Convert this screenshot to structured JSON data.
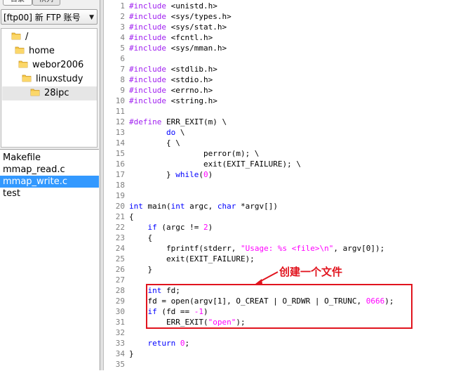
{
  "sidebar": {
    "tabs": [
      {
        "label": "目录"
      },
      {
        "label": "队列"
      }
    ],
    "account_selector": {
      "value": "[ftp00] 新 FTP 账号"
    },
    "tree": [
      {
        "label": "/",
        "depth": 0
      },
      {
        "label": "home",
        "depth": 1
      },
      {
        "label": "webor2006",
        "depth": 2
      },
      {
        "label": "linuxstudy",
        "depth": 3
      },
      {
        "label": "28ipc",
        "depth": 4,
        "selected": true
      }
    ],
    "files": [
      {
        "name": "Makefile"
      },
      {
        "name": "mmap_read.c"
      },
      {
        "name": "mmap_write.c",
        "selected": true
      },
      {
        "name": "test"
      }
    ]
  },
  "editor": {
    "lines": [
      {
        "n": "1",
        "code": [
          [
            "pp",
            "#include "
          ],
          [
            "",
            "<unistd.h>"
          ]
        ]
      },
      {
        "n": "2",
        "code": [
          [
            "pp",
            "#include "
          ],
          [
            "",
            "<sys/types.h>"
          ]
        ]
      },
      {
        "n": "3",
        "code": [
          [
            "pp",
            "#include "
          ],
          [
            "",
            "<sys/stat.h>"
          ]
        ]
      },
      {
        "n": "4",
        "code": [
          [
            "pp",
            "#include "
          ],
          [
            "",
            "<fcntl.h>"
          ]
        ]
      },
      {
        "n": "5",
        "code": [
          [
            "pp",
            "#include "
          ],
          [
            "",
            "<sys/mman.h>"
          ]
        ]
      },
      {
        "n": "6",
        "code": []
      },
      {
        "n": "7",
        "code": [
          [
            "pp",
            "#include "
          ],
          [
            "",
            "<stdlib.h>"
          ]
        ]
      },
      {
        "n": "8",
        "code": [
          [
            "pp",
            "#include "
          ],
          [
            "",
            "<stdio.h>"
          ]
        ]
      },
      {
        "n": "9",
        "code": [
          [
            "pp",
            "#include "
          ],
          [
            "",
            "<errno.h>"
          ]
        ]
      },
      {
        "n": "10",
        "code": [
          [
            "pp",
            "#include "
          ],
          [
            "",
            "<string.h>"
          ]
        ]
      },
      {
        "n": "11",
        "code": []
      },
      {
        "n": "12",
        "code": [
          [
            "pp",
            "#define "
          ],
          [
            "",
            "ERR_EXIT(m) \\"
          ]
        ]
      },
      {
        "n": "13",
        "code": [
          [
            "",
            "        "
          ],
          [
            "kw",
            "do"
          ],
          [
            "",
            " \\"
          ]
        ]
      },
      {
        "n": "14",
        "code": [
          [
            "",
            "        { \\"
          ]
        ]
      },
      {
        "n": "15",
        "code": [
          [
            "",
            "                perror(m); \\"
          ]
        ]
      },
      {
        "n": "16",
        "code": [
          [
            "",
            "                exit(EXIT_FAILURE); \\"
          ]
        ]
      },
      {
        "n": "17",
        "code": [
          [
            "",
            "        } "
          ],
          [
            "kw",
            "while"
          ],
          [
            "",
            "("
          ],
          [
            "num",
            "0"
          ],
          [
            "",
            ")"
          ]
        ]
      },
      {
        "n": "18",
        "code": []
      },
      {
        "n": "19",
        "code": []
      },
      {
        "n": "20",
        "code": [
          [
            "kw",
            "int"
          ],
          [
            "",
            " main("
          ],
          [
            "kw",
            "int"
          ],
          [
            "",
            " argc, "
          ],
          [
            "kw",
            "char"
          ],
          [
            "",
            " *argv[])"
          ]
        ]
      },
      {
        "n": "21",
        "code": [
          [
            "",
            "{"
          ]
        ]
      },
      {
        "n": "22",
        "code": [
          [
            "",
            "    "
          ],
          [
            "kw",
            "if"
          ],
          [
            "",
            " (argc != "
          ],
          [
            "num",
            "2"
          ],
          [
            "",
            ")"
          ]
        ]
      },
      {
        "n": "23",
        "code": [
          [
            "",
            "    {"
          ]
        ]
      },
      {
        "n": "24",
        "code": [
          [
            "",
            "        fprintf(stderr, "
          ],
          [
            "str",
            "\"Usage: %s <file>\\n\""
          ],
          [
            "",
            ", argv[0]);"
          ]
        ]
      },
      {
        "n": "25",
        "code": [
          [
            "",
            "        exit(EXIT_FAILURE);"
          ]
        ]
      },
      {
        "n": "26",
        "code": [
          [
            "",
            "    }"
          ]
        ]
      },
      {
        "n": "27",
        "code": []
      },
      {
        "n": "28",
        "code": [
          [
            "",
            "    "
          ],
          [
            "kw",
            "int"
          ],
          [
            "",
            " fd;"
          ]
        ]
      },
      {
        "n": "29",
        "code": [
          [
            "",
            "    fd = open(argv[1], O_CREAT | O_RDWR | O_TRUNC, "
          ],
          [
            "num",
            "0666"
          ],
          [
            "",
            ");"
          ]
        ]
      },
      {
        "n": "30",
        "code": [
          [
            "",
            "    "
          ],
          [
            "kw",
            "if"
          ],
          [
            "",
            " (fd == "
          ],
          [
            "num",
            "-1"
          ],
          [
            "",
            ")"
          ]
        ]
      },
      {
        "n": "31",
        "code": [
          [
            "",
            "        ERR_EXIT("
          ],
          [
            "str",
            "\"open\""
          ],
          [
            "",
            ");"
          ]
        ]
      },
      {
        "n": "32",
        "code": []
      },
      {
        "n": "33",
        "code": [
          [
            "",
            "    "
          ],
          [
            "kw",
            "return"
          ],
          [
            "",
            " "
          ],
          [
            "num",
            "0"
          ],
          [
            "",
            ";"
          ]
        ]
      },
      {
        "n": "34",
        "code": [
          [
            "",
            "}"
          ]
        ]
      },
      {
        "n": "35",
        "code": []
      }
    ]
  },
  "annotation": {
    "label": "创建一个文件",
    "color": "#e1141e"
  }
}
